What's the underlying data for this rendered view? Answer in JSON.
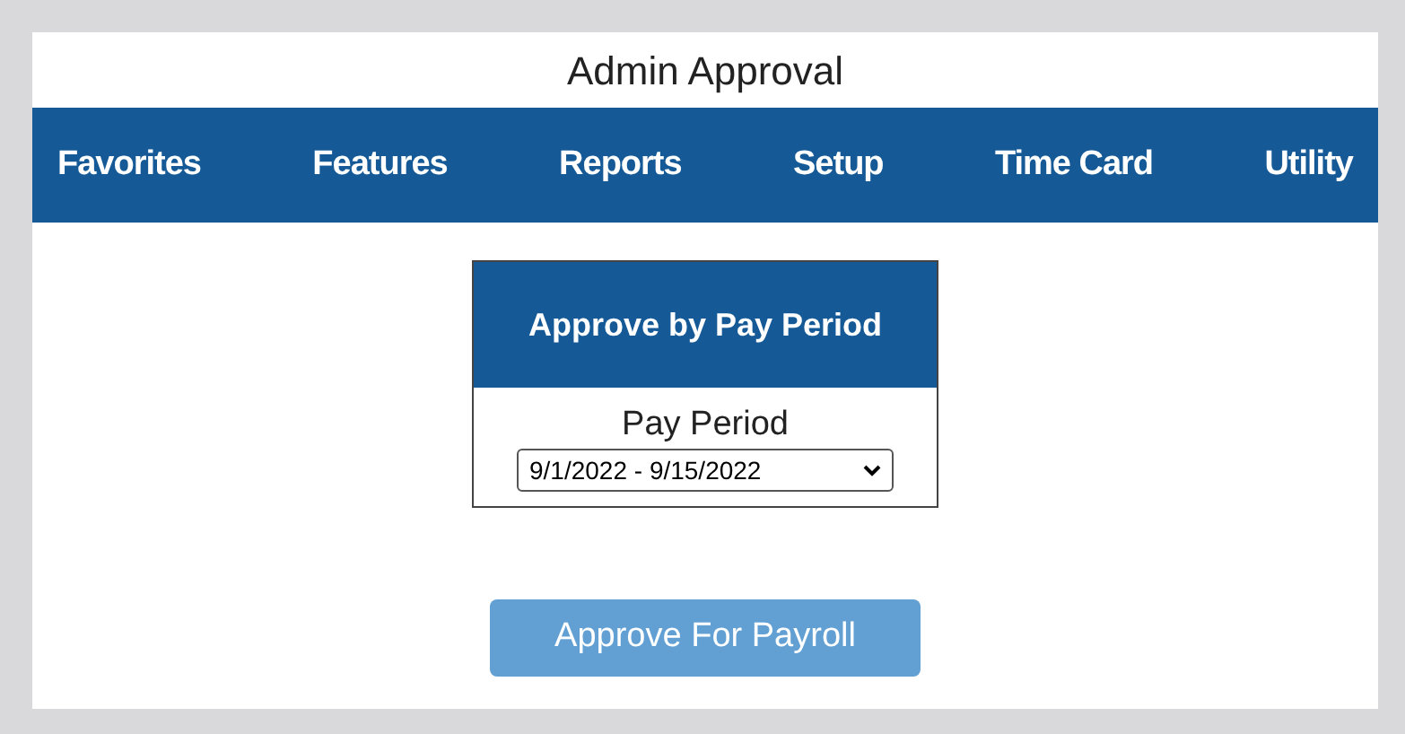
{
  "window": {
    "title": "Admin Approval"
  },
  "nav": {
    "items": [
      "Favorites",
      "Features",
      "Reports",
      "Setup",
      "Time Card",
      "Utility"
    ]
  },
  "card": {
    "title": "Approve by Pay Period",
    "field_label": "Pay Period",
    "select_value": "9/1/2022 - 9/15/2022"
  },
  "button": {
    "label": "Approve For Payroll"
  }
}
